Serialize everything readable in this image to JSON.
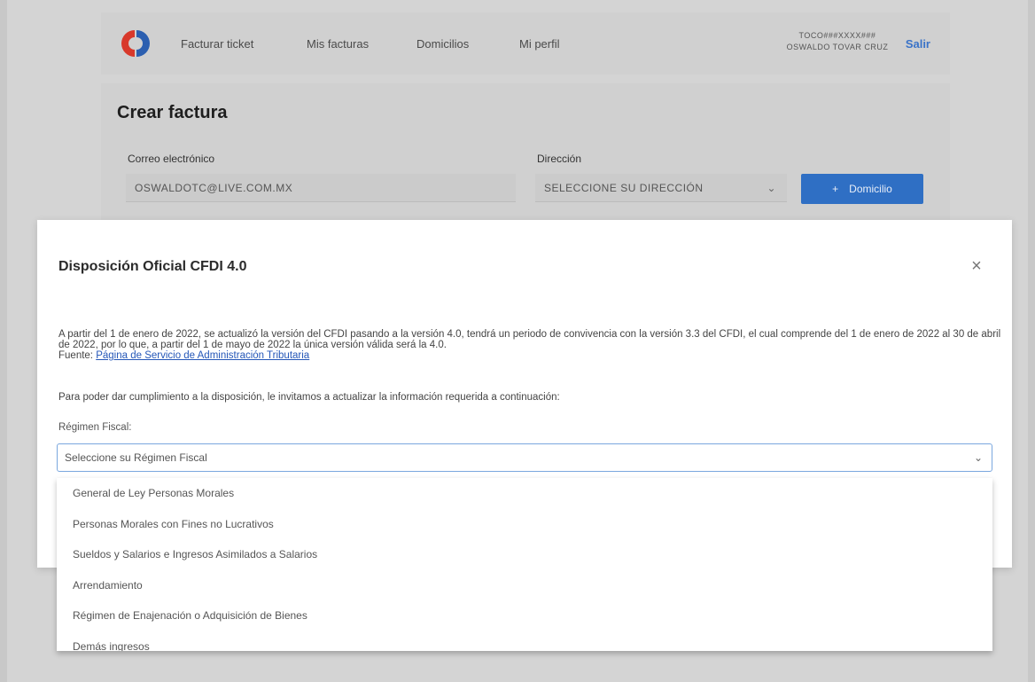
{
  "nav": {
    "links": [
      "Facturar ticket",
      "Mis facturas",
      "Domicilios",
      "Mi perfil"
    ],
    "user_rfc": "TOCO###XXXX###",
    "user_name": "OSWALDO TOVAR CRUZ",
    "logout": "Salir"
  },
  "form": {
    "title": "Crear factura",
    "email_label": "Correo electrónico",
    "email_value": "OSWALDOTC@LIVE.COM.MX",
    "address_label": "Dirección",
    "address_value": "SELECCIONE SU DIRECCIÓN",
    "add_address_button": "Domicilio"
  },
  "modal": {
    "title": "Disposición Oficial CFDI 4.0",
    "body": "A partir del 1 de enero de 2022, se actualizó la versión del CFDI pasando a la versión 4.0, tendrá un periodo de convivencia con la versión 3.3 del CFDI, el cual comprende del 1 de enero de 2022 al 30 de abril de 2022, por lo que, a partir del 1 de mayo de 2022 la única versión válida será la 4.0.",
    "source_prefix": "Fuente:",
    "source_link": "Página de Servicio de Administración Tributaria",
    "invite": "Para poder dar cumplimiento a la disposición, le invitamos a actualizar la información requerida a continuación:",
    "regimen_label": "Régimen Fiscal:",
    "regimen_placeholder": "Seleccione su Régimen Fiscal",
    "regimen_options": [
      "General de Ley Personas Morales",
      "Personas Morales con Fines no Lucrativos",
      "Sueldos y Salarios e Ingresos Asimilados a Salarios",
      "Arrendamiento",
      "Régimen de Enajenación o Adquisición de Bienes",
      "Demás ingresos"
    ]
  },
  "colors": {
    "accent": "#2f6fc4",
    "link": "#2557b8",
    "logo_red": "#d8392b",
    "logo_blue": "#2c5fb0"
  }
}
